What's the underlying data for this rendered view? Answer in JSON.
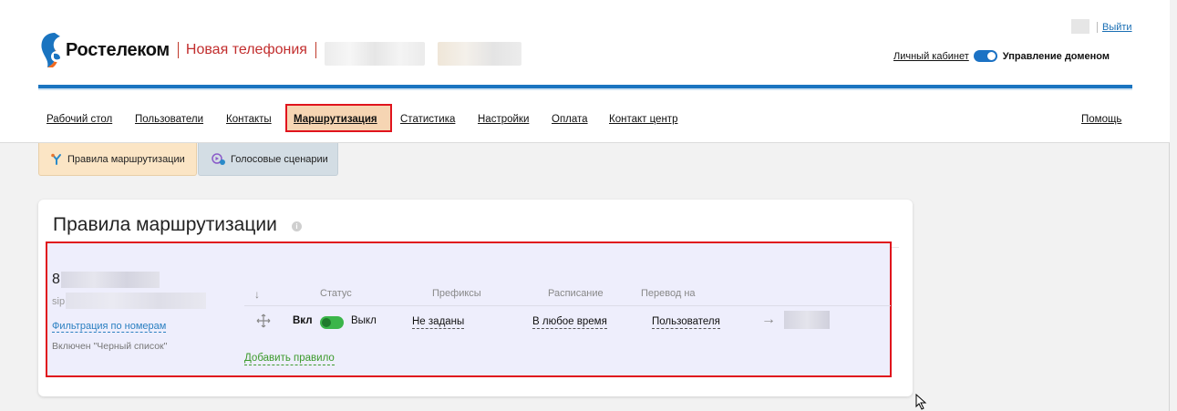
{
  "brand": {
    "name": "Ростелеком",
    "product": "Новая телефония"
  },
  "topbar": {
    "logout": "Выйти",
    "cabinet_link": "Личный кабинет",
    "domain_management": "Управление доменом"
  },
  "nav": {
    "items": [
      "Рабочий стол",
      "Пользователи",
      "Контакты",
      "Маршрутизация",
      "Статистика",
      "Настройки",
      "Оплата",
      "Контакт центр"
    ],
    "active": "Маршрутизация",
    "help": "Помощь"
  },
  "subtabs": [
    "Правила маршрутизации",
    "Голосовые сценарии"
  ],
  "card": {
    "title": "Правила маршрутизации",
    "info_glyph": "i"
  },
  "rule": {
    "phone_prefix": "8",
    "sip_prefix": "sip:",
    "filter_link": "Фильтрация по номерам",
    "blacklist_note": "Включен \"Черный список\"",
    "sort_arrow": "↓",
    "columns": [
      "Статус",
      "Префиксы",
      "Расписание",
      "Перевод на"
    ],
    "status_on": "Вкл",
    "status_off": "Выкл",
    "prefixes": "Не заданы",
    "schedule": "В любое время",
    "transfer_to": "Пользователя",
    "arrow": "→",
    "add_rule": "Добавить правило"
  },
  "colors": {
    "accent_blue": "#1a74c0",
    "brand_red": "#c22e2e",
    "highlight_red": "#e0141d",
    "toggle_green": "#3bb54a"
  }
}
